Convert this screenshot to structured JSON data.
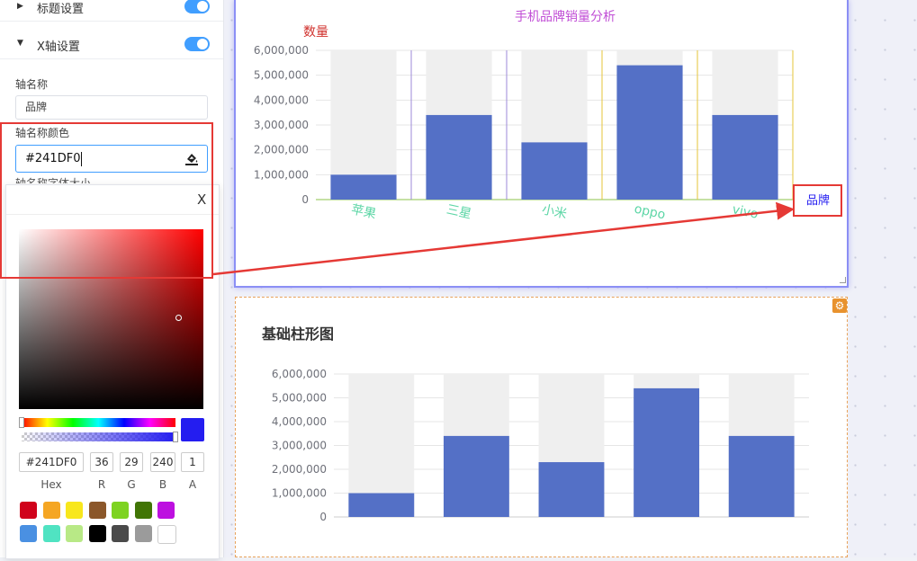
{
  "panel": {
    "title_section": {
      "label": "标题设置",
      "enabled": true
    },
    "xaxis_section": {
      "label": "X轴设置",
      "enabled": true
    },
    "axis_name_label": "轴名称",
    "axis_name_value": "品牌",
    "axis_name_color_label": "轴名称颜色",
    "axis_name_color_value": "#241DF0",
    "axis_name_fontsize_label": "轴名称字体大小"
  },
  "picker": {
    "close": "X",
    "hex": "#241DF0",
    "r": "36",
    "g": "29",
    "b": "240",
    "a": "1",
    "cap_hex": "Hex",
    "cap_r": "R",
    "cap_g": "G",
    "cap_b": "B",
    "cap_a": "A",
    "current_color": "#241DF0",
    "presets": [
      "#d0021b",
      "#f5a623",
      "#f8e71c",
      "#8b572a",
      "#7ed321",
      "#417505",
      "#bd10e0",
      "#4a90e2",
      "#50e3c2",
      "#b8e986",
      "#000000",
      "#4a4a4a",
      "#9b9b9b",
      "#ffffff"
    ]
  },
  "colors": {
    "bar": "#5470c6",
    "bar_bg": "#efefef",
    "accent": "#409eff",
    "annotation": "#e53935"
  },
  "chart_data": [
    {
      "type": "bar",
      "title": "手机品牌销量分析",
      "ylabel": "数量",
      "xlabel": "品牌",
      "categories": [
        "苹果",
        "三星",
        "小米",
        "oppo",
        "vivo"
      ],
      "values": [
        1000000,
        3400000,
        2300000,
        5400000,
        3400000
      ],
      "ylim": [
        0,
        6000000
      ],
      "yticks": [
        "0",
        "1,000,000",
        "2,000,000",
        "3,000,000",
        "4,000,000",
        "5,000,000",
        "6,000,000"
      ],
      "title_color": "#c14fd6",
      "ylabel_color": "#d0312d",
      "xlabel_color": "#241DF0",
      "category_label_color": "#5dd6a6",
      "show_background": true
    },
    {
      "type": "bar",
      "title": "基础柱形图",
      "values": [
        1000000,
        3400000,
        2300000,
        5400000,
        3400000
      ],
      "ylim": [
        0,
        6000000
      ],
      "yticks": [
        "0",
        "1,000,000",
        "2,000,000",
        "3,000,000",
        "4,000,000",
        "5,000,000",
        "6,000,000"
      ],
      "show_background": true
    }
  ]
}
